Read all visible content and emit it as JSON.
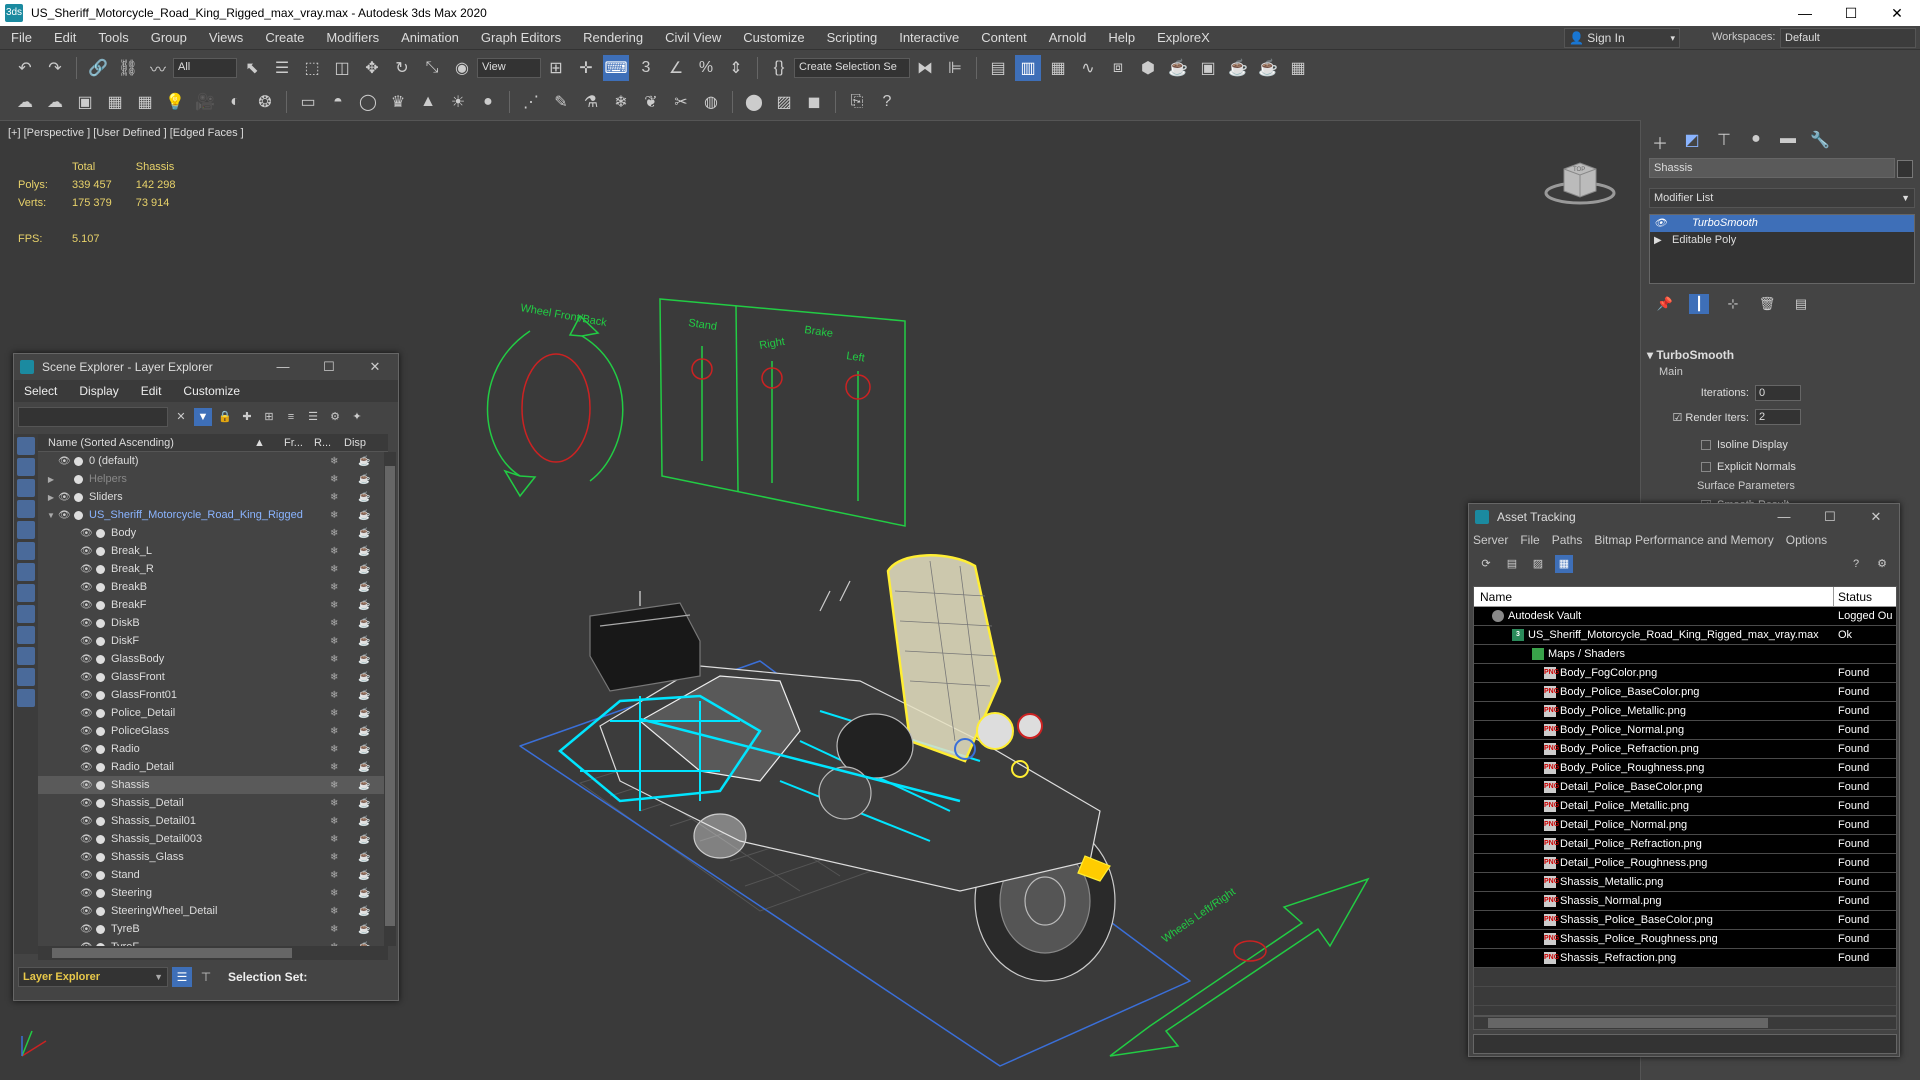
{
  "title_bar": {
    "title": "US_Sheriff_Motorcycle_Road_King_Rigged_max_vray.max - Autodesk 3ds Max 2020",
    "app_icon": "3ds",
    "minimize": "—",
    "maximize": "☐",
    "close": "✕"
  },
  "menu": [
    "File",
    "Edit",
    "Tools",
    "Group",
    "Views",
    "Create",
    "Modifiers",
    "Animation",
    "Graph Editors",
    "Rendering",
    "Civil View",
    "Customize",
    "Scripting",
    "Interactive",
    "Content",
    "Arnold",
    "Help",
    "ExploreX"
  ],
  "signin": {
    "label": "Sign In",
    "arrow": "▾"
  },
  "workspaces": {
    "label": "Workspaces:",
    "value": "Default"
  },
  "toolbar": {
    "selection_filter": "All",
    "ref_coord": "View",
    "named_selection": "Create Selection Se"
  },
  "viewport": {
    "label": "[+] [Perspective ] [User Defined ] [Edged Faces ]",
    "stats": {
      "col_total": "Total",
      "col_sel": "Shassis",
      "polys_label": "Polys:",
      "polys_total": "339 457",
      "polys_sel": "142 298",
      "verts_label": "Verts:",
      "verts_total": "175 379",
      "verts_sel": "73 914",
      "fps_label": "FPS:",
      "fps_value": "5.107"
    },
    "helper_labels": {
      "wheel_front_back": "Wheel Front/Back",
      "stand": "Stand",
      "brake": "Brake",
      "right": "Right",
      "left": "Left",
      "wheels_left_right": "Wheels Left/Right"
    },
    "cube_label": "TOP"
  },
  "command_panel": {
    "object_name": "Shassis",
    "modifier_list": "Modifier List",
    "stack": [
      {
        "label": "TurboSmooth"
      },
      {
        "label": "Editable Poly"
      }
    ],
    "rollout_title": "TurboSmooth",
    "main_group": "Main",
    "iterations_label": "Iterations:",
    "iterations_value": "0",
    "render_iters_label": "Render Iters:",
    "render_iters_value": "2",
    "isoline_display": "Isoline Display",
    "explicit_normals": "Explicit Normals",
    "surface_params": "Surface Parameters",
    "smooth_result": "Smooth Result"
  },
  "scene_explorer": {
    "title": "Scene Explorer - Layer Explorer",
    "menu": [
      "Select",
      "Display",
      "Edit",
      "Customize"
    ],
    "col_name": "Name (Sorted Ascending)",
    "col_frozen": "Fr...",
    "col_render": "R...",
    "col_display": "Disp",
    "rows": [
      {
        "name": "0 (default)",
        "exp": "",
        "style": "",
        "eye": "👁"
      },
      {
        "name": "Helpers",
        "exp": "▶",
        "style": "dim",
        "eye": ""
      },
      {
        "name": "Sliders",
        "exp": "▶",
        "style": "",
        "eye": "👁"
      },
      {
        "name": "US_Sheriff_Motorcycle_Road_King_Rigged",
        "exp": "▼",
        "style": "bl",
        "eye": "👁"
      },
      {
        "name": "Body",
        "exp": "",
        "style": "",
        "eye": "👁"
      },
      {
        "name": "Break_L",
        "exp": "",
        "style": "",
        "eye": "👁"
      },
      {
        "name": "Break_R",
        "exp": "",
        "style": "",
        "eye": "👁"
      },
      {
        "name": "BreakB",
        "exp": "",
        "style": "",
        "eye": "👁"
      },
      {
        "name": "BreakF",
        "exp": "",
        "style": "",
        "eye": "👁"
      },
      {
        "name": "DiskB",
        "exp": "",
        "style": "",
        "eye": "👁"
      },
      {
        "name": "DiskF",
        "exp": "",
        "style": "",
        "eye": "👁"
      },
      {
        "name": "GlassBody",
        "exp": "",
        "style": "",
        "eye": "👁"
      },
      {
        "name": "GlassFront",
        "exp": "",
        "style": "",
        "eye": "👁"
      },
      {
        "name": "GlassFront01",
        "exp": "",
        "style": "",
        "eye": "👁"
      },
      {
        "name": "Police_Detail",
        "exp": "",
        "style": "",
        "eye": "👁"
      },
      {
        "name": "PoliceGlass",
        "exp": "",
        "style": "",
        "eye": "👁"
      },
      {
        "name": "Radio",
        "exp": "",
        "style": "",
        "eye": "👁"
      },
      {
        "name": "Radio_Detail",
        "exp": "",
        "style": "",
        "eye": "👁"
      },
      {
        "name": "Shassis",
        "exp": "",
        "style": "hl",
        "eye": "👁"
      },
      {
        "name": "Shassis_Detail",
        "exp": "",
        "style": "",
        "eye": "👁"
      },
      {
        "name": "Shassis_Detail01",
        "exp": "",
        "style": "",
        "eye": "👁"
      },
      {
        "name": "Shassis_Detail003",
        "exp": "",
        "style": "",
        "eye": "👁"
      },
      {
        "name": "Shassis_Glass",
        "exp": "",
        "style": "",
        "eye": "👁"
      },
      {
        "name": "Stand",
        "exp": "",
        "style": "",
        "eye": "👁"
      },
      {
        "name": "Steering",
        "exp": "",
        "style": "",
        "eye": "👁"
      },
      {
        "name": "SteeringWheel_Detail",
        "exp": "",
        "style": "",
        "eye": "👁"
      },
      {
        "name": "TyreB",
        "exp": "",
        "style": "",
        "eye": "👁"
      },
      {
        "name": "TyreF",
        "exp": "",
        "style": "",
        "eye": "👁"
      }
    ],
    "footer_explorer": "Layer Explorer",
    "footer_selection_set": "Selection Set:"
  },
  "asset_tracking": {
    "title": "Asset Tracking",
    "menu": [
      "Server",
      "File",
      "Paths",
      "Bitmap Performance and Memory",
      "Options"
    ],
    "col_name": "Name",
    "col_status": "Status",
    "rows": [
      {
        "name": "Autodesk Vault",
        "status": "Logged Ou",
        "indent": 18,
        "icon": "v",
        "icon_text": ""
      },
      {
        "name": "US_Sheriff_Motorcycle_Road_King_Rigged_max_vray.max",
        "status": "Ok",
        "indent": 38,
        "icon": "f",
        "icon_text": "3"
      },
      {
        "name": "Maps / Shaders",
        "status": "",
        "indent": 58,
        "icon": "m",
        "icon_text": ""
      },
      {
        "name": "Body_FogColor.png",
        "status": "Found",
        "indent": 70,
        "icon": "p",
        "icon_text": "PNG"
      },
      {
        "name": "Body_Police_BaseColor.png",
        "status": "Found",
        "indent": 70,
        "icon": "p",
        "icon_text": "PNG"
      },
      {
        "name": "Body_Police_Metallic.png",
        "status": "Found",
        "indent": 70,
        "icon": "p",
        "icon_text": "PNG"
      },
      {
        "name": "Body_Police_Normal.png",
        "status": "Found",
        "indent": 70,
        "icon": "p",
        "icon_text": "PNG"
      },
      {
        "name": "Body_Police_Refraction.png",
        "status": "Found",
        "indent": 70,
        "icon": "p",
        "icon_text": "PNG"
      },
      {
        "name": "Body_Police_Roughness.png",
        "status": "Found",
        "indent": 70,
        "icon": "p",
        "icon_text": "PNG"
      },
      {
        "name": "Detail_Police_BaseColor.png",
        "status": "Found",
        "indent": 70,
        "icon": "p",
        "icon_text": "PNG"
      },
      {
        "name": "Detail_Police_Metallic.png",
        "status": "Found",
        "indent": 70,
        "icon": "p",
        "icon_text": "PNG"
      },
      {
        "name": "Detail_Police_Normal.png",
        "status": "Found",
        "indent": 70,
        "icon": "p",
        "icon_text": "PNG"
      },
      {
        "name": "Detail_Police_Refraction.png",
        "status": "Found",
        "indent": 70,
        "icon": "p",
        "icon_text": "PNG"
      },
      {
        "name": "Detail_Police_Roughness.png",
        "status": "Found",
        "indent": 70,
        "icon": "p",
        "icon_text": "PNG"
      },
      {
        "name": "Shassis_Metallic.png",
        "status": "Found",
        "indent": 70,
        "icon": "p",
        "icon_text": "PNG"
      },
      {
        "name": "Shassis_Normal.png",
        "status": "Found",
        "indent": 70,
        "icon": "p",
        "icon_text": "PNG"
      },
      {
        "name": "Shassis_Police_BaseColor.png",
        "status": "Found",
        "indent": 70,
        "icon": "p",
        "icon_text": "PNG"
      },
      {
        "name": "Shassis_Police_Roughness.png",
        "status": "Found",
        "indent": 70,
        "icon": "p",
        "icon_text": "PNG"
      },
      {
        "name": "Shassis_Refraction.png",
        "status": "Found",
        "indent": 70,
        "icon": "p",
        "icon_text": "PNG"
      }
    ]
  },
  "colors": {
    "accent": "#3e6fb8",
    "stats": "#e8d26a",
    "helper_green": "#22cc44",
    "selection_cyan": "#00e5ff",
    "selection_yellow": "#ffee33",
    "wire": "#cccccc"
  }
}
